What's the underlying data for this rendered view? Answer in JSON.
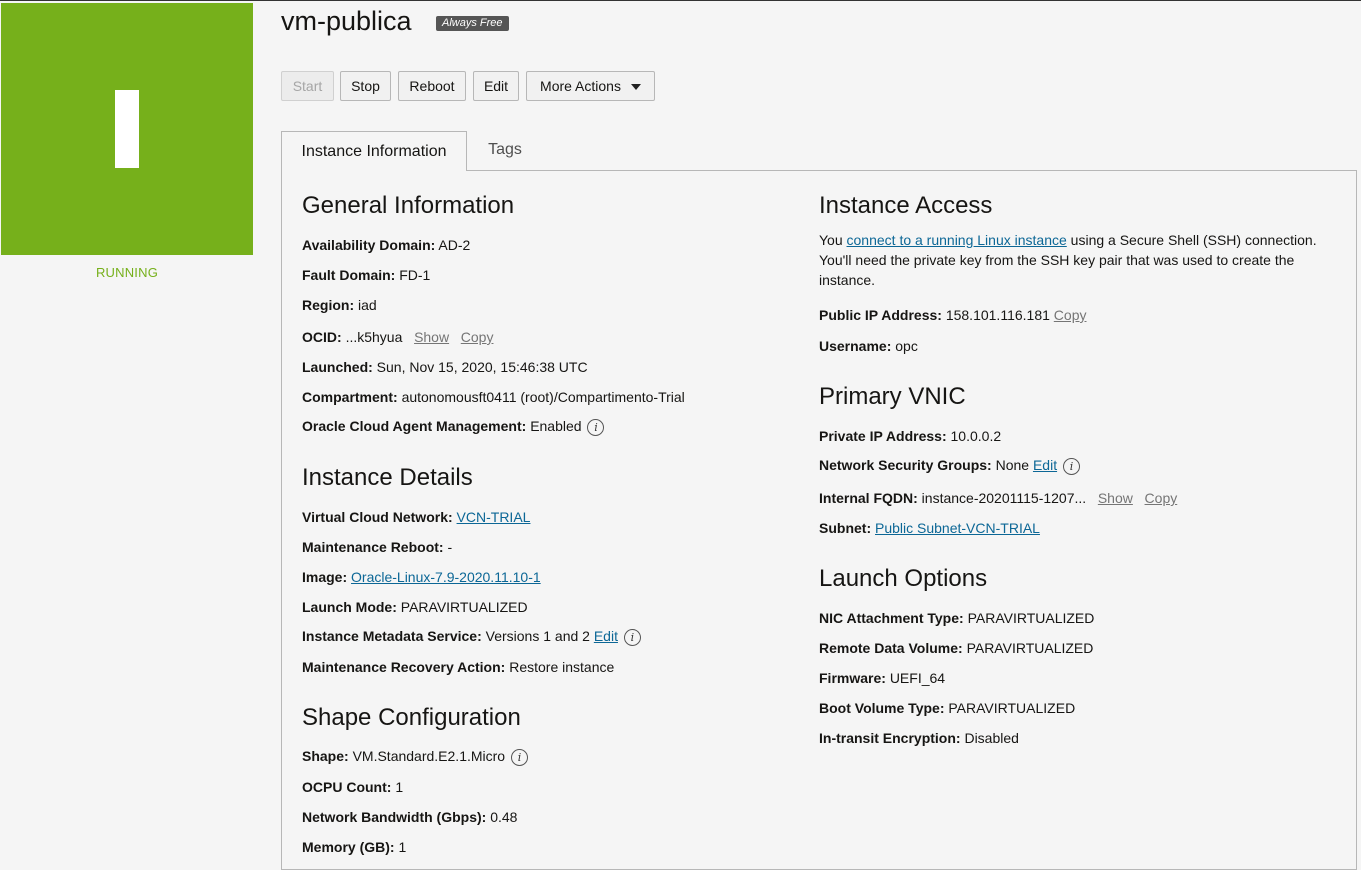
{
  "instance": {
    "name": "vm-publica",
    "badge": "Always Free",
    "status": "RUNNING",
    "status_color": "#76b01b"
  },
  "toolbar": {
    "start": "Start",
    "stop": "Stop",
    "reboot": "Reboot",
    "edit": "Edit",
    "more_actions": "More Actions"
  },
  "tabs": {
    "active": "Instance Information",
    "other": "Tags"
  },
  "general": {
    "heading": "General Information",
    "ad_label": "Availability Domain:",
    "ad_value": "AD-2",
    "fd_label": "Fault Domain:",
    "fd_value": "FD-1",
    "region_label": "Region:",
    "region_value": "iad",
    "ocid_label": "OCID:",
    "ocid_value": "...k5hyua",
    "ocid_show": "Show",
    "ocid_copy": "Copy",
    "launched_label": "Launched:",
    "launched_value": "Sun, Nov 15, 2020, 15:46:38 UTC",
    "compartment_label": "Compartment:",
    "compartment_value": "autonomousft0411 (root)/Compartimento-Trial",
    "agent_label": "Oracle Cloud Agent Management:",
    "agent_value": "Enabled"
  },
  "details": {
    "heading": "Instance Details",
    "vcn_label": "Virtual Cloud Network:",
    "vcn_value": "VCN-TRIAL",
    "maint_reboot_label": "Maintenance Reboot:",
    "maint_reboot_value": "-",
    "image_label": "Image:",
    "image_value": "Oracle-Linux-7.9-2020.11.10-1",
    "launch_mode_label": "Launch Mode:",
    "launch_mode_value": "PARAVIRTUALIZED",
    "imds_label": "Instance Metadata Service:",
    "imds_value": "Versions 1 and 2",
    "imds_edit": "Edit",
    "recovery_label": "Maintenance Recovery Action:",
    "recovery_value": "Restore instance"
  },
  "shape": {
    "heading": "Shape Configuration",
    "shape_label": "Shape:",
    "shape_value": "VM.Standard.E2.1.Micro",
    "ocpu_label": "OCPU Count:",
    "ocpu_value": "1",
    "bw_label": "Network Bandwidth (Gbps):",
    "bw_value": "0.48",
    "mem_label": "Memory (GB):",
    "mem_value": "1"
  },
  "access": {
    "heading": "Instance Access",
    "text_1": "You ",
    "link": "connect to a running Linux instance",
    "text_2": " using a Secure Shell (SSH) connection. You'll need the private key from the SSH key pair that was used to create the instance.",
    "ip_label": "Public IP Address:",
    "ip_value": "158.101.116.181",
    "ip_copy": "Copy",
    "user_label": "Username:",
    "user_value": "opc"
  },
  "vnic": {
    "heading": "Primary VNIC",
    "private_ip_label": "Private IP Address:",
    "private_ip_value": "10.0.0.2",
    "nsg_label": "Network Security Groups:",
    "nsg_value": "None",
    "nsg_edit": "Edit",
    "fqdn_label": "Internal FQDN:",
    "fqdn_value": "instance-20201115-1207...",
    "fqdn_show": "Show",
    "fqdn_copy": "Copy",
    "subnet_label": "Subnet:",
    "subnet_value": "Public Subnet-VCN-TRIAL"
  },
  "launch": {
    "heading": "Launch Options",
    "nic_label": "NIC Attachment Type:",
    "nic_value": "PARAVIRTUALIZED",
    "rdv_label": "Remote Data Volume:",
    "rdv_value": "PARAVIRTUALIZED",
    "fw_label": "Firmware:",
    "fw_value": "UEFI_64",
    "bvt_label": "Boot Volume Type:",
    "bvt_value": "PARAVIRTUALIZED",
    "enc_label": "In-transit Encryption:",
    "enc_value": "Disabled"
  },
  "icons": {
    "info": "info-icon",
    "dropdown": "caret-down-icon",
    "status": "instance-status-icon"
  }
}
